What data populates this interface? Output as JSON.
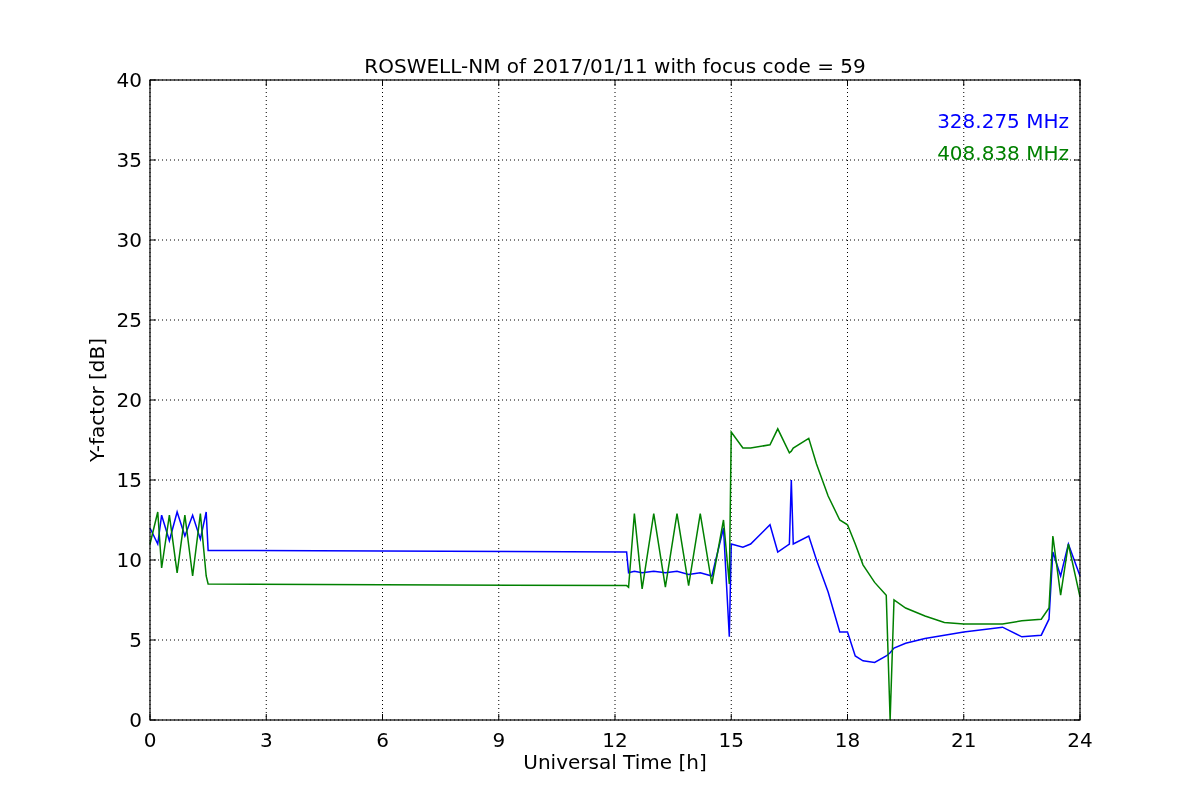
{
  "chart_data": {
    "type": "line",
    "grid": true,
    "title": "ROSWELL-NM of 2017/01/11 with focus code = 59",
    "xlabel": "Universal Time [h]",
    "ylabel": "Y-factor [dB]",
    "xlim": [
      0,
      24
    ],
    "ylim": [
      0,
      40
    ],
    "xticks": [
      0,
      3,
      6,
      9,
      12,
      15,
      18,
      21,
      24
    ],
    "yticks": [
      0,
      5,
      10,
      15,
      20,
      25,
      30,
      35,
      40
    ],
    "x": [
      0,
      0.2,
      0.3,
      0.5,
      0.7,
      0.9,
      1.1,
      1.3,
      1.45,
      1.5,
      12.3,
      12.35,
      12.5,
      12.7,
      13,
      13.3,
      13.6,
      13.9,
      14.2,
      14.5,
      14.8,
      14.95,
      15,
      15.3,
      15.5,
      16,
      16.2,
      16.5,
      16.55,
      16.6,
      17,
      17.2,
      17.5,
      17.8,
      18,
      18.2,
      18.4,
      18.7,
      19,
      19.1,
      19.2,
      19.5,
      20,
      20.5,
      21,
      22,
      22.5,
      23,
      23.2,
      23.3,
      23.5,
      23.7,
      24
    ],
    "series": [
      {
        "name": "328.275 MHz",
        "color": "#0000ff",
        "values": [
          12,
          11,
          12.8,
          11.2,
          13,
          11.5,
          12.8,
          11.3,
          13,
          10.6,
          10.5,
          9.2,
          9.3,
          9.2,
          9.3,
          9.2,
          9.3,
          9.1,
          9.2,
          9.0,
          12,
          5.2,
          11,
          10.8,
          11,
          12.2,
          10.5,
          11,
          15,
          11,
          11.5,
          10,
          8,
          5.5,
          5.5,
          4,
          3.7,
          3.6,
          4,
          4.2,
          4.5,
          4.8,
          5.1,
          5.3,
          5.5,
          5.8,
          5.2,
          5.3,
          6.3,
          10.5,
          9,
          11,
          9
        ]
      },
      {
        "name": "408.838 MHz",
        "color": "#008000",
        "values": [
          11,
          13,
          9.5,
          12.8,
          9.2,
          12.8,
          9.0,
          12.9,
          9.0,
          8.5,
          8.4,
          8.3,
          12.9,
          8.2,
          12.9,
          8.3,
          12.9,
          8.4,
          12.9,
          8.5,
          12.5,
          8.5,
          18,
          17,
          17,
          17.2,
          18.2,
          16.7,
          16.8,
          17,
          17.6,
          16,
          14,
          12.5,
          12.2,
          11,
          9.7,
          8.6,
          7.8,
          0,
          7.5,
          7,
          6.5,
          6.1,
          6,
          6,
          6.2,
          6.3,
          7,
          11.5,
          7.8,
          11,
          7.7
        ]
      }
    ]
  }
}
